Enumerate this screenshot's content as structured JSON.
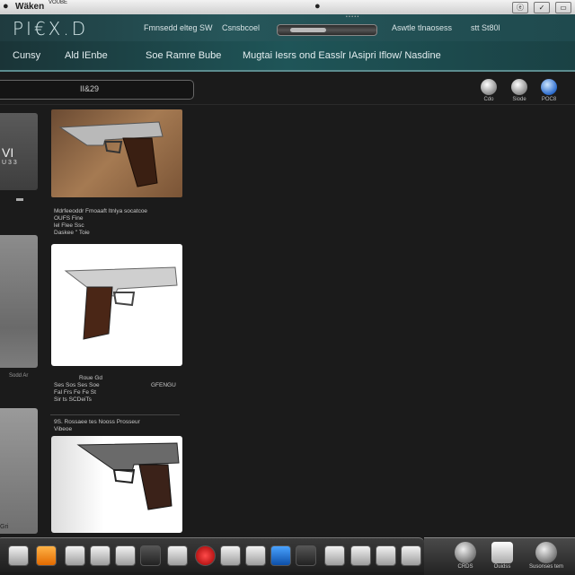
{
  "menubar": {
    "app_name": "Wäken",
    "app_sub": "VOUBE",
    "tray": [
      "ⓔ",
      "✓",
      "▭"
    ]
  },
  "header": {
    "logo": "PI€X.D",
    "link1": "Fmnsedd elteg SW",
    "link2": "Csnsbcoel",
    "link3": "Aswtle tlnaosess",
    "link4": "stt St80l"
  },
  "nav": {
    "tabs": [
      "Cunsy",
      "Ald IEnbe",
      "Soe Ramre Bube",
      "Mugtai Iesrs ond Easslr IAsipri Iflow/ Nasdine"
    ]
  },
  "address": {
    "value": "II&29"
  },
  "toolbar": {
    "items": [
      {
        "label": "Cdo",
        "icon": "download-icon"
      },
      {
        "label": "Siode",
        "icon": "share-icon"
      },
      {
        "label": "POC8",
        "icon": "globe-icon"
      }
    ]
  },
  "left_cards": {
    "card1_title": "VI",
    "card1_sub": "U 3 3",
    "card2_caption": "Sodd Ar",
    "card3_caption": "Gri"
  },
  "products": [
    {
      "caption_lines": [
        "Mdrfeeoddr Fmoaaft Itnlya socatcoe",
        "OUFS Fine",
        "lel Flee Ssc",
        "Daskee \" Toie"
      ]
    },
    {
      "caption_top": "Roue Gd",
      "caption_lines": [
        "Ses Sos   Ses Soe",
        "Fal Frs   Fe Fe St",
        "Sir ts   SCDeiTs"
      ],
      "caption_right": "GFENGU"
    },
    {
      "caption_lines": [
        "9S. Rossaee   tes   Nooss Prosseur",
        "Vibeoe"
      ]
    }
  ],
  "dock": {
    "icons": [
      "finder-icon",
      "notes-icon",
      "safari-icon",
      "photos-icon",
      "camera-icon",
      "barcode-icon",
      "terminal-icon",
      "calendar-icon",
      "rose-icon",
      "disk-icon",
      "itunes-icon",
      "xcode-icon",
      "chart-icon",
      "window-icon",
      "pen-icon",
      "edit-icon",
      "file-icon"
    ]
  },
  "tray": {
    "items": [
      {
        "label": "CRDS",
        "icon": "sphere-icon"
      },
      {
        "label": "Ouidss",
        "icon": "card-icon"
      },
      {
        "label": "Susonses tem",
        "icon": "rotate-icon"
      }
    ]
  }
}
